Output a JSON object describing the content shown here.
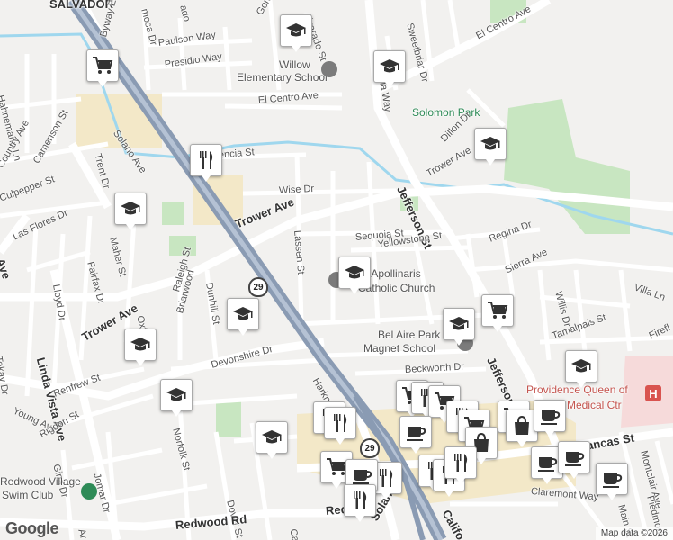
{
  "map": {
    "attribution": "Map data ©2026",
    "logo": "Google",
    "colors": {
      "background": "#f2f1ef",
      "road": "#ffffff",
      "freeway": "#8a9bb3",
      "park": "#c8e6c1",
      "water": "#9fd7ee",
      "commercial": "#f3e8c8",
      "hospital": "#f6dada"
    }
  },
  "labels": {
    "salvador": "SALVADOR",
    "el_centro_ave_ne": "El Centro Ave",
    "el_centro_ave": "El Centro Ave",
    "willow_school": "Willow",
    "willow_school_2": "Elementary School",
    "paulson_way": "Paulson Way",
    "presidio_way": "Presidio Way",
    "byway_e": "Byway E",
    "hahnemann_ln": "Hahnemann Ln",
    "solano_ave": "Solano Ave",
    "trent_dr": "Trent Dr",
    "camenson_st": "Camenson St",
    "country_ave": "Country Ave",
    "valencia_st": "Valencia St",
    "wise_dr": "Wise Dr",
    "trower_ave": "Trower Ave",
    "trower_ave_w": "Trower Ave",
    "trower_ave_ne": "Trower Ave",
    "lassen_st": "Lassen St",
    "sequoia_st": "Sequoia St",
    "yellowstone_st": "Yellowstone St",
    "regina_dr": "Regina Dr",
    "jefferson_st": "Jefferson St",
    "jefferson_st_s": "Jefferson St",
    "st_apollinaris": "St. Apollinaris",
    "st_apollinaris_2": "Catholic Church",
    "sierra_ave": "Sierra Ave",
    "villa_ln": "Villa Ln",
    "willis_dr": "Willis Dr",
    "tamalpais_st": "Tamalpais St",
    "firefly": "Firefl",
    "bel_aire_park": "Bel Aire Park",
    "bel_aire_park_2": "Magnet School",
    "beckworth_dr": "Beckworth Dr",
    "solomon_park": "Solomon Park",
    "dillon_dr": "Dillon Dr",
    "wisteria_way": "Wisteria Way",
    "sweetbriar_dr": "Sweetbriar Dr",
    "gordon_st": "Gordon St",
    "alvarado_st": "Alvarado St",
    "providence_1": "Providence Queen of",
    "providence_2": "Medical Ctr",
    "trancas_st": "Trancas St",
    "montclair_ave": "Montclair Ave",
    "piedmont": "Piedmont",
    "main_st": "Main St",
    "claremont_way": "Claremont Way",
    "culpepper_st": "Culpepper St",
    "las_flores_dr": "Las Flores Dr",
    "maher_st": "Maher St",
    "fairfax_dr": "Fairfax Dr",
    "lloyd_dr": "Lloyd Dr",
    "linda_vista_ave": "Linda Vista Ave",
    "dunhill_st": "Dunhill St",
    "raleigh_st": "Raleigh St",
    "briarwood": "Briarwood",
    "oxford": "Oxford",
    "tokay_dr": "Tokay Dr",
    "young_ave": "Young Ave",
    "renfrew_st": "Renfrew St",
    "devonshire_dr": "Devonshire Dr",
    "harkness_st": "Harkness St",
    "rigdon_st": "Rigdon St",
    "norfolk_st": "Norfolk St",
    "gina_dr": "Gina Dr",
    "jomar_dr": "Jomar Dr",
    "dover_st": "Dover St",
    "redwood_village": "Redwood Village",
    "redwood_village_2": "Swim Club",
    "redwood_rd": "Redwood Rd",
    "redwood_rd_e": "Red",
    "solano_s": "Solano",
    "california": "Califo",
    "ar": "Ar",
    "ca": "Ca",
    "ave": "Ave",
    "ermosa": "mosa Dr",
    "ado": "ado"
  },
  "route_shields": [
    "29",
    "29"
  ],
  "hospital_icon": "H",
  "pins": [
    {
      "icon": "school-icon"
    },
    {
      "icon": "school-icon"
    },
    {
      "icon": "grocery-icon"
    },
    {
      "icon": "school-icon"
    },
    {
      "icon": "restaurant-icon"
    },
    {
      "icon": "school-icon"
    },
    {
      "icon": "school-icon"
    },
    {
      "icon": "grocery-icon"
    },
    {
      "icon": "school-icon"
    },
    {
      "icon": "school-icon"
    },
    {
      "icon": "school-icon"
    },
    {
      "icon": "school-icon"
    },
    {
      "icon": "school-icon"
    },
    {
      "icon": "school-icon"
    },
    {
      "icon": "restaurant-icon"
    },
    {
      "icon": "grocery-icon"
    },
    {
      "icon": "restaurant-icon"
    },
    {
      "icon": "grocery-icon"
    },
    {
      "icon": "restaurant-icon"
    },
    {
      "icon": "restaurant-icon"
    },
    {
      "icon": "grocery-icon"
    },
    {
      "icon": "cafe-icon"
    },
    {
      "icon": "grocery-icon"
    },
    {
      "icon": "shopping-icon"
    },
    {
      "icon": "cafe-icon"
    },
    {
      "icon": "shopping-icon"
    },
    {
      "icon": "cafe-icon"
    },
    {
      "icon": "cafe-icon"
    },
    {
      "icon": "restaurant-icon"
    },
    {
      "icon": "restaurant-icon"
    },
    {
      "icon": "restaurant-icon"
    },
    {
      "icon": "grocery-icon"
    },
    {
      "icon": "restaurant-icon"
    },
    {
      "icon": "cafe-icon"
    },
    {
      "icon": "cafe-icon"
    },
    {
      "icon": "restaurant-icon"
    }
  ]
}
